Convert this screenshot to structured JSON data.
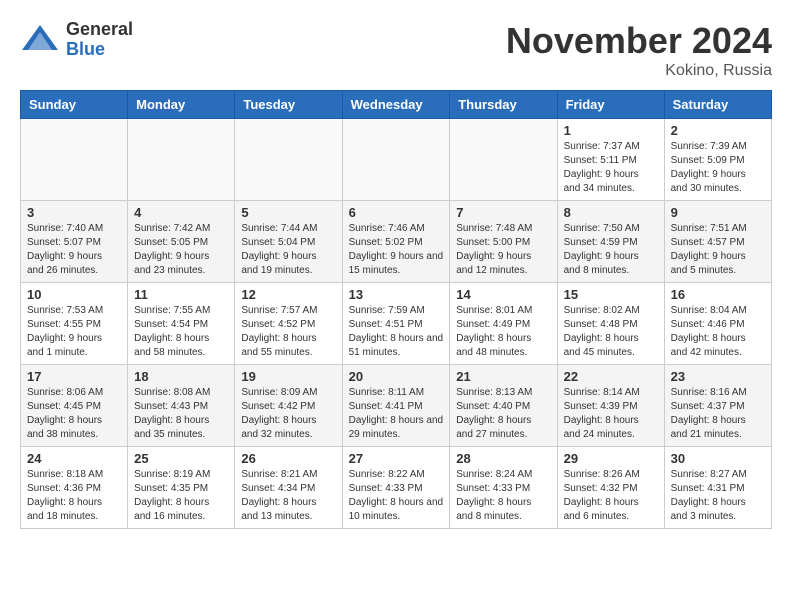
{
  "header": {
    "logo_general": "General",
    "logo_blue": "Blue",
    "month": "November 2024",
    "location": "Kokino, Russia"
  },
  "weekdays": [
    "Sunday",
    "Monday",
    "Tuesday",
    "Wednesday",
    "Thursday",
    "Friday",
    "Saturday"
  ],
  "weeks": [
    [
      {
        "day": "",
        "info": ""
      },
      {
        "day": "",
        "info": ""
      },
      {
        "day": "",
        "info": ""
      },
      {
        "day": "",
        "info": ""
      },
      {
        "day": "",
        "info": ""
      },
      {
        "day": "1",
        "info": "Sunrise: 7:37 AM\nSunset: 5:11 PM\nDaylight: 9 hours and 34 minutes."
      },
      {
        "day": "2",
        "info": "Sunrise: 7:39 AM\nSunset: 5:09 PM\nDaylight: 9 hours and 30 minutes."
      }
    ],
    [
      {
        "day": "3",
        "info": "Sunrise: 7:40 AM\nSunset: 5:07 PM\nDaylight: 9 hours and 26 minutes."
      },
      {
        "day": "4",
        "info": "Sunrise: 7:42 AM\nSunset: 5:05 PM\nDaylight: 9 hours and 23 minutes."
      },
      {
        "day": "5",
        "info": "Sunrise: 7:44 AM\nSunset: 5:04 PM\nDaylight: 9 hours and 19 minutes."
      },
      {
        "day": "6",
        "info": "Sunrise: 7:46 AM\nSunset: 5:02 PM\nDaylight: 9 hours and 15 minutes."
      },
      {
        "day": "7",
        "info": "Sunrise: 7:48 AM\nSunset: 5:00 PM\nDaylight: 9 hours and 12 minutes."
      },
      {
        "day": "8",
        "info": "Sunrise: 7:50 AM\nSunset: 4:59 PM\nDaylight: 9 hours and 8 minutes."
      },
      {
        "day": "9",
        "info": "Sunrise: 7:51 AM\nSunset: 4:57 PM\nDaylight: 9 hours and 5 minutes."
      }
    ],
    [
      {
        "day": "10",
        "info": "Sunrise: 7:53 AM\nSunset: 4:55 PM\nDaylight: 9 hours and 1 minute."
      },
      {
        "day": "11",
        "info": "Sunrise: 7:55 AM\nSunset: 4:54 PM\nDaylight: 8 hours and 58 minutes."
      },
      {
        "day": "12",
        "info": "Sunrise: 7:57 AM\nSunset: 4:52 PM\nDaylight: 8 hours and 55 minutes."
      },
      {
        "day": "13",
        "info": "Sunrise: 7:59 AM\nSunset: 4:51 PM\nDaylight: 8 hours and 51 minutes."
      },
      {
        "day": "14",
        "info": "Sunrise: 8:01 AM\nSunset: 4:49 PM\nDaylight: 8 hours and 48 minutes."
      },
      {
        "day": "15",
        "info": "Sunrise: 8:02 AM\nSunset: 4:48 PM\nDaylight: 8 hours and 45 minutes."
      },
      {
        "day": "16",
        "info": "Sunrise: 8:04 AM\nSunset: 4:46 PM\nDaylight: 8 hours and 42 minutes."
      }
    ],
    [
      {
        "day": "17",
        "info": "Sunrise: 8:06 AM\nSunset: 4:45 PM\nDaylight: 8 hours and 38 minutes."
      },
      {
        "day": "18",
        "info": "Sunrise: 8:08 AM\nSunset: 4:43 PM\nDaylight: 8 hours and 35 minutes."
      },
      {
        "day": "19",
        "info": "Sunrise: 8:09 AM\nSunset: 4:42 PM\nDaylight: 8 hours and 32 minutes."
      },
      {
        "day": "20",
        "info": "Sunrise: 8:11 AM\nSunset: 4:41 PM\nDaylight: 8 hours and 29 minutes."
      },
      {
        "day": "21",
        "info": "Sunrise: 8:13 AM\nSunset: 4:40 PM\nDaylight: 8 hours and 27 minutes."
      },
      {
        "day": "22",
        "info": "Sunrise: 8:14 AM\nSunset: 4:39 PM\nDaylight: 8 hours and 24 minutes."
      },
      {
        "day": "23",
        "info": "Sunrise: 8:16 AM\nSunset: 4:37 PM\nDaylight: 8 hours and 21 minutes."
      }
    ],
    [
      {
        "day": "24",
        "info": "Sunrise: 8:18 AM\nSunset: 4:36 PM\nDaylight: 8 hours and 18 minutes."
      },
      {
        "day": "25",
        "info": "Sunrise: 8:19 AM\nSunset: 4:35 PM\nDaylight: 8 hours and 16 minutes."
      },
      {
        "day": "26",
        "info": "Sunrise: 8:21 AM\nSunset: 4:34 PM\nDaylight: 8 hours and 13 minutes."
      },
      {
        "day": "27",
        "info": "Sunrise: 8:22 AM\nSunset: 4:33 PM\nDaylight: 8 hours and 10 minutes."
      },
      {
        "day": "28",
        "info": "Sunrise: 8:24 AM\nSunset: 4:33 PM\nDaylight: 8 hours and 8 minutes."
      },
      {
        "day": "29",
        "info": "Sunrise: 8:26 AM\nSunset: 4:32 PM\nDaylight: 8 hours and 6 minutes."
      },
      {
        "day": "30",
        "info": "Sunrise: 8:27 AM\nSunset: 4:31 PM\nDaylight: 8 hours and 3 minutes."
      }
    ]
  ]
}
